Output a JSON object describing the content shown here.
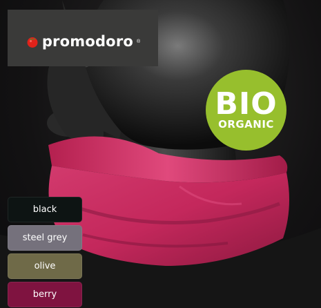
{
  "brand": {
    "name": "promodoro",
    "registered_mark": "®",
    "logo_icon": "tomato-icon"
  },
  "badge": {
    "line1": "BIO",
    "line2": "ORGANIC",
    "color": "#97bf2d"
  },
  "colors": [
    {
      "label": "black",
      "hex": "#0d1413"
    },
    {
      "label": "steel grey",
      "hex": "#75717c"
    },
    {
      "label": "olive",
      "hex": "#6f6a48"
    },
    {
      "label": "berry",
      "hex": "#7f1340"
    }
  ]
}
